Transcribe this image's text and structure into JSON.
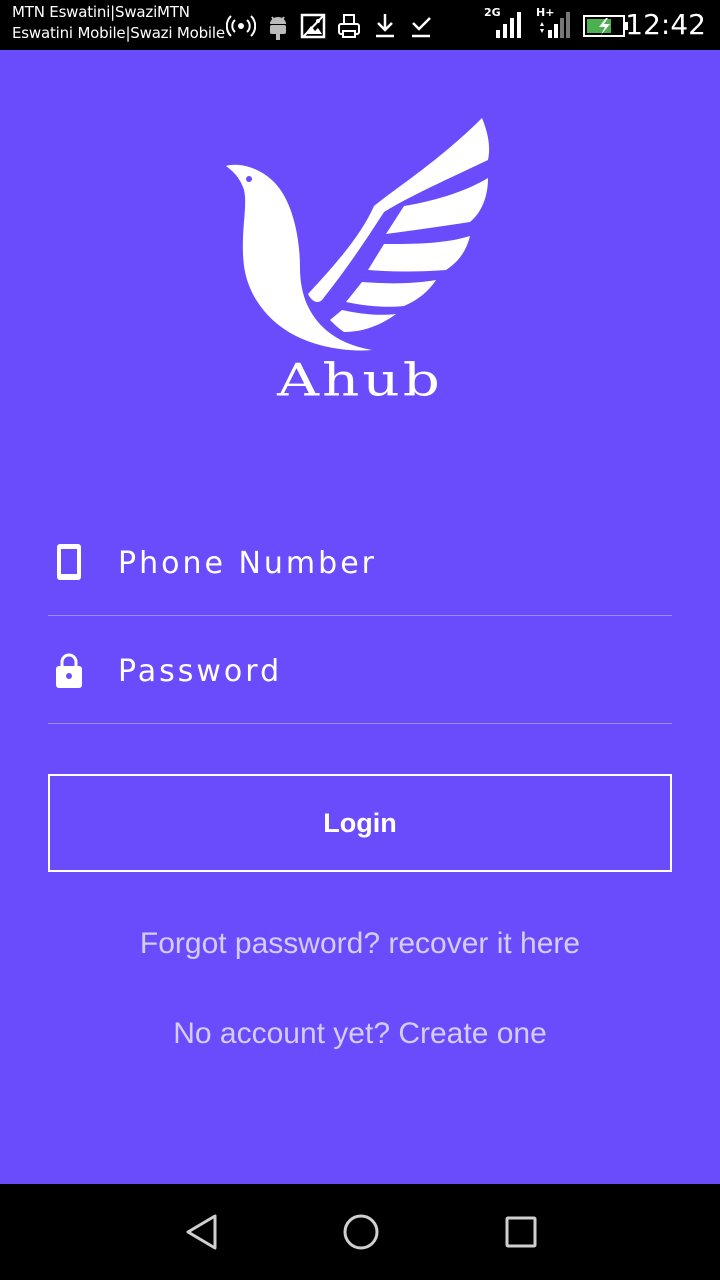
{
  "status_bar": {
    "carrier_line1": "MTN Eswatini|SwaziMTN",
    "carrier_line2": "Eswatini Mobile|Swazi Mobile",
    "network_label_1": "2G",
    "network_label_2": "H+",
    "time": "12:42",
    "icons": [
      "hotspot-icon",
      "android-debug-icon",
      "image-icon",
      "print-icon",
      "download-icon",
      "check-icon",
      "signal-icon",
      "signal-icon",
      "battery-charging-icon"
    ]
  },
  "logo": {
    "text": "Ahub",
    "icon": "dove-wing-logo"
  },
  "form": {
    "phone_placeholder": "Phone Number",
    "phone_icon": "phone-icon",
    "password_placeholder": "Password",
    "password_icon": "lock-icon",
    "login_label": "Login"
  },
  "links": {
    "forgot": "Forgot password? recover it here",
    "create": "No account yet? Create one"
  },
  "nav": {
    "icons": [
      "back-icon",
      "home-icon",
      "recents-icon"
    ]
  },
  "colors": {
    "background": "#6a4cfd",
    "link_text": "#d4cdfd",
    "bars": "#000000"
  }
}
